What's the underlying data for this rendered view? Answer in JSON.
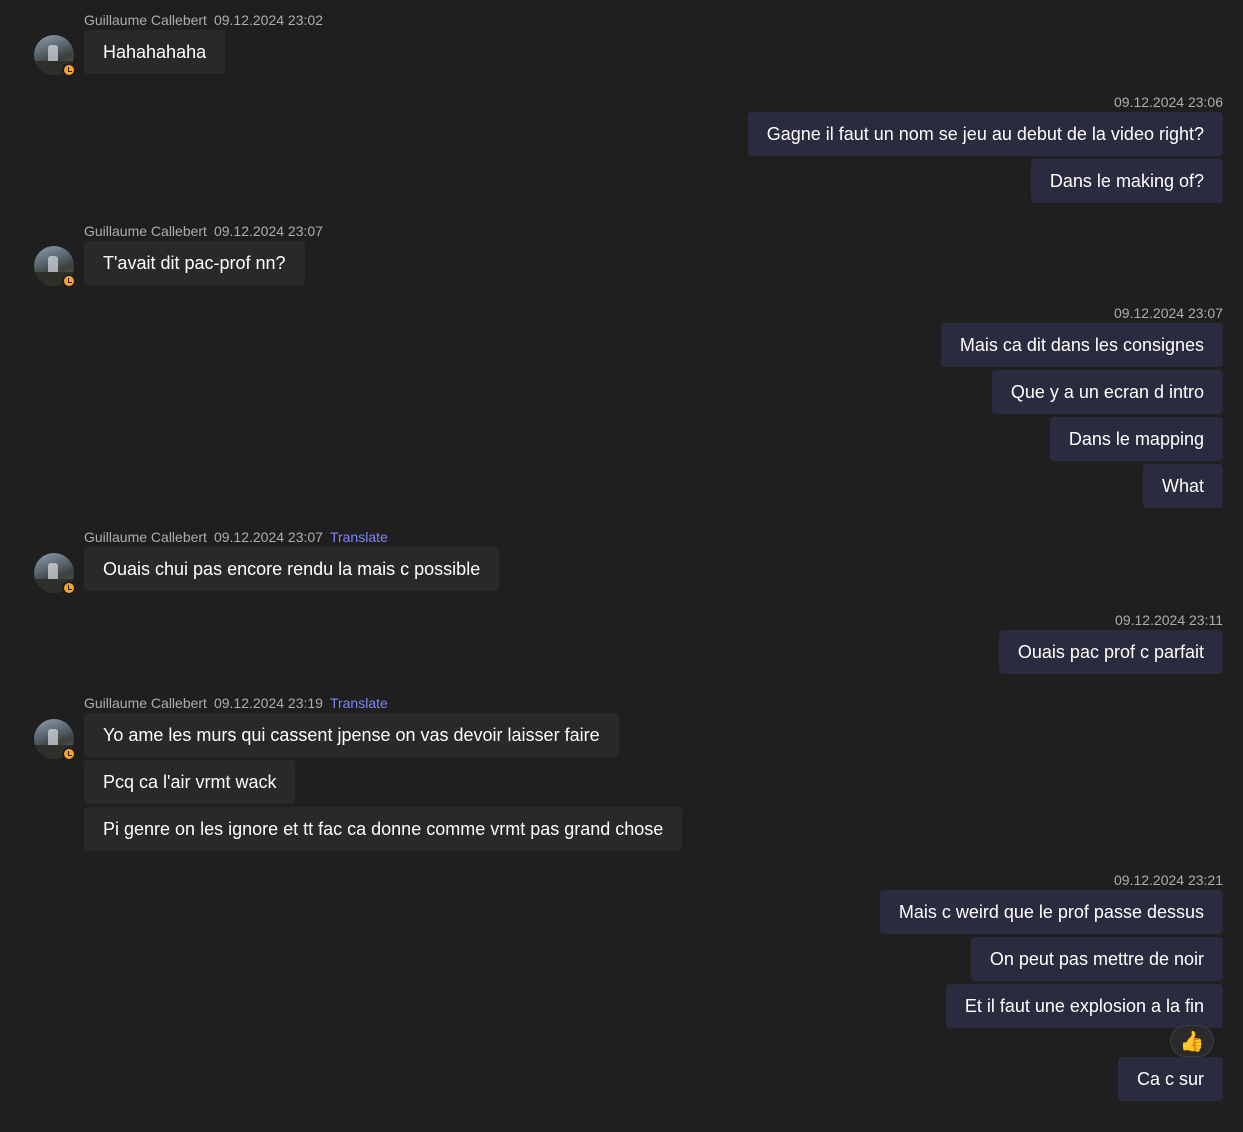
{
  "incoming_author": "Guillaume Callebert",
  "translate_label": "Translate",
  "groups": [
    {
      "side": "in",
      "time": "09.12.2024 23:02",
      "messages": [
        "Hahahahaha"
      ]
    },
    {
      "side": "out",
      "time": "09.12.2024 23:06",
      "messages": [
        "Gagne il faut un nom se jeu au debut de la video right?",
        "Dans le making of?"
      ]
    },
    {
      "side": "in",
      "time": "09.12.2024 23:07",
      "messages": [
        "T'avait dit pac-prof nn?"
      ]
    },
    {
      "side": "out",
      "time": "09.12.2024 23:07",
      "messages": [
        "Mais ca dit dans les consignes",
        "Que y a un ecran d intro",
        "Dans le mapping",
        "What"
      ]
    },
    {
      "side": "in",
      "time": "09.12.2024 23:07",
      "translate": true,
      "messages": [
        "Ouais chui pas encore rendu la mais c possible"
      ]
    },
    {
      "side": "out",
      "time": "09.12.2024 23:11",
      "messages": [
        "Ouais pac prof c parfait"
      ]
    },
    {
      "side": "in",
      "time": "09.12.2024 23:19",
      "translate": true,
      "messages": [
        "Yo ame les murs qui cassent jpense on vas devoir laisser faire",
        "Pcq ca l'air vrmt wack",
        "Pi genre on les ignore et tt fac ca donne comme vrmt pas grand chose"
      ]
    },
    {
      "side": "out",
      "time": "09.12.2024 23:21",
      "messages": [
        "Mais c weird que le prof passe dessus",
        "On peut pas mettre de noir",
        "Et il faut une explosion a la fin",
        "Ca c sur"
      ]
    }
  ],
  "reaction": {
    "icon": "thumbs-up-icon",
    "glyph": "👍",
    "color": "#f4b400"
  },
  "colors": {
    "background": "#1f1f1f",
    "incoming_bubble": "#292929",
    "outgoing_bubble": "#2b2b40",
    "accent": "#7f85f5",
    "status": "#f8a12c"
  }
}
